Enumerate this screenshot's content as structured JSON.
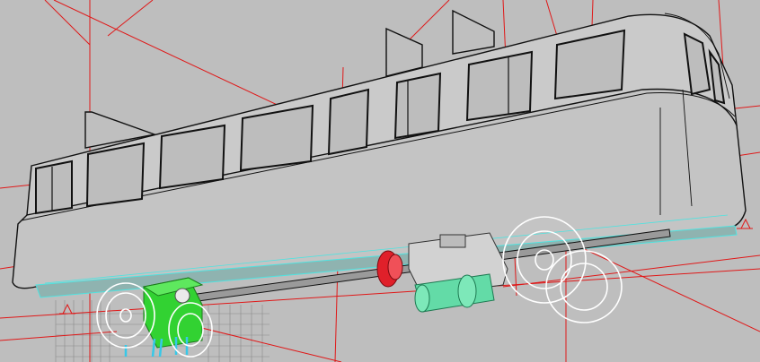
{
  "viewport": {
    "label": "",
    "background": "#bebebe"
  },
  "colors": {
    "construction_lines": "#e01818",
    "body_fill": "#c6c6c6",
    "body_edges": "#111111",
    "underside_edges": "#4fe3e0",
    "wheel_edges": "#ffffff",
    "motor_block": "#32d232",
    "coupler_red": "#e0202a",
    "gearbox_green": "#63dba7",
    "connector_cyan": "#37c8e8",
    "grid": "#8a8a8a"
  },
  "model": {
    "kind": "rail car body with bogies",
    "selected_objects": [
      "motor-block",
      "front-wheelset",
      "rear-wheelset",
      "drive-shaft"
    ]
  }
}
